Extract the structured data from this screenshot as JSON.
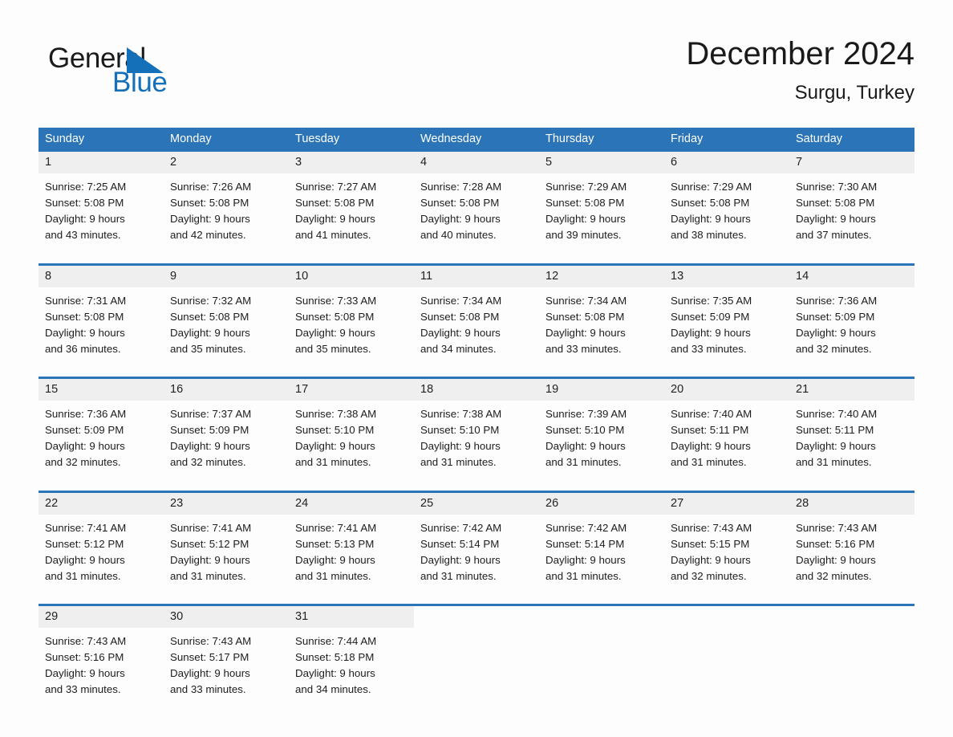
{
  "brand": {
    "name_part1": "General",
    "name_part2": "Blue",
    "accent_color": "#1470b8",
    "triangle_icon": "brand-triangle-icon"
  },
  "header": {
    "month_title": "December 2024",
    "location": "Surgu, Turkey"
  },
  "calendar": {
    "header_bg": "#2a74b7",
    "daynum_bg": "#efefef",
    "weekdays": [
      "Sunday",
      "Monday",
      "Tuesday",
      "Wednesday",
      "Thursday",
      "Friday",
      "Saturday"
    ],
    "weeks": [
      [
        {
          "day": "1",
          "sunrise": "Sunrise: 7:25 AM",
          "sunset": "Sunset: 5:08 PM",
          "daylight_line1": "Daylight: 9 hours",
          "daylight_line2": "and 43 minutes."
        },
        {
          "day": "2",
          "sunrise": "Sunrise: 7:26 AM",
          "sunset": "Sunset: 5:08 PM",
          "daylight_line1": "Daylight: 9 hours",
          "daylight_line2": "and 42 minutes."
        },
        {
          "day": "3",
          "sunrise": "Sunrise: 7:27 AM",
          "sunset": "Sunset: 5:08 PM",
          "daylight_line1": "Daylight: 9 hours",
          "daylight_line2": "and 41 minutes."
        },
        {
          "day": "4",
          "sunrise": "Sunrise: 7:28 AM",
          "sunset": "Sunset: 5:08 PM",
          "daylight_line1": "Daylight: 9 hours",
          "daylight_line2": "and 40 minutes."
        },
        {
          "day": "5",
          "sunrise": "Sunrise: 7:29 AM",
          "sunset": "Sunset: 5:08 PM",
          "daylight_line1": "Daylight: 9 hours",
          "daylight_line2": "and 39 minutes."
        },
        {
          "day": "6",
          "sunrise": "Sunrise: 7:29 AM",
          "sunset": "Sunset: 5:08 PM",
          "daylight_line1": "Daylight: 9 hours",
          "daylight_line2": "and 38 minutes."
        },
        {
          "day": "7",
          "sunrise": "Sunrise: 7:30 AM",
          "sunset": "Sunset: 5:08 PM",
          "daylight_line1": "Daylight: 9 hours",
          "daylight_line2": "and 37 minutes."
        }
      ],
      [
        {
          "day": "8",
          "sunrise": "Sunrise: 7:31 AM",
          "sunset": "Sunset: 5:08 PM",
          "daylight_line1": "Daylight: 9 hours",
          "daylight_line2": "and 36 minutes."
        },
        {
          "day": "9",
          "sunrise": "Sunrise: 7:32 AM",
          "sunset": "Sunset: 5:08 PM",
          "daylight_line1": "Daylight: 9 hours",
          "daylight_line2": "and 35 minutes."
        },
        {
          "day": "10",
          "sunrise": "Sunrise: 7:33 AM",
          "sunset": "Sunset: 5:08 PM",
          "daylight_line1": "Daylight: 9 hours",
          "daylight_line2": "and 35 minutes."
        },
        {
          "day": "11",
          "sunrise": "Sunrise: 7:34 AM",
          "sunset": "Sunset: 5:08 PM",
          "daylight_line1": "Daylight: 9 hours",
          "daylight_line2": "and 34 minutes."
        },
        {
          "day": "12",
          "sunrise": "Sunrise: 7:34 AM",
          "sunset": "Sunset: 5:08 PM",
          "daylight_line1": "Daylight: 9 hours",
          "daylight_line2": "and 33 minutes."
        },
        {
          "day": "13",
          "sunrise": "Sunrise: 7:35 AM",
          "sunset": "Sunset: 5:09 PM",
          "daylight_line1": "Daylight: 9 hours",
          "daylight_line2": "and 33 minutes."
        },
        {
          "day": "14",
          "sunrise": "Sunrise: 7:36 AM",
          "sunset": "Sunset: 5:09 PM",
          "daylight_line1": "Daylight: 9 hours",
          "daylight_line2": "and 32 minutes."
        }
      ],
      [
        {
          "day": "15",
          "sunrise": "Sunrise: 7:36 AM",
          "sunset": "Sunset: 5:09 PM",
          "daylight_line1": "Daylight: 9 hours",
          "daylight_line2": "and 32 minutes."
        },
        {
          "day": "16",
          "sunrise": "Sunrise: 7:37 AM",
          "sunset": "Sunset: 5:09 PM",
          "daylight_line1": "Daylight: 9 hours",
          "daylight_line2": "and 32 minutes."
        },
        {
          "day": "17",
          "sunrise": "Sunrise: 7:38 AM",
          "sunset": "Sunset: 5:10 PM",
          "daylight_line1": "Daylight: 9 hours",
          "daylight_line2": "and 31 minutes."
        },
        {
          "day": "18",
          "sunrise": "Sunrise: 7:38 AM",
          "sunset": "Sunset: 5:10 PM",
          "daylight_line1": "Daylight: 9 hours",
          "daylight_line2": "and 31 minutes."
        },
        {
          "day": "19",
          "sunrise": "Sunrise: 7:39 AM",
          "sunset": "Sunset: 5:10 PM",
          "daylight_line1": "Daylight: 9 hours",
          "daylight_line2": "and 31 minutes."
        },
        {
          "day": "20",
          "sunrise": "Sunrise: 7:40 AM",
          "sunset": "Sunset: 5:11 PM",
          "daylight_line1": "Daylight: 9 hours",
          "daylight_line2": "and 31 minutes."
        },
        {
          "day": "21",
          "sunrise": "Sunrise: 7:40 AM",
          "sunset": "Sunset: 5:11 PM",
          "daylight_line1": "Daylight: 9 hours",
          "daylight_line2": "and 31 minutes."
        }
      ],
      [
        {
          "day": "22",
          "sunrise": "Sunrise: 7:41 AM",
          "sunset": "Sunset: 5:12 PM",
          "daylight_line1": "Daylight: 9 hours",
          "daylight_line2": "and 31 minutes."
        },
        {
          "day": "23",
          "sunrise": "Sunrise: 7:41 AM",
          "sunset": "Sunset: 5:12 PM",
          "daylight_line1": "Daylight: 9 hours",
          "daylight_line2": "and 31 minutes."
        },
        {
          "day": "24",
          "sunrise": "Sunrise: 7:41 AM",
          "sunset": "Sunset: 5:13 PM",
          "daylight_line1": "Daylight: 9 hours",
          "daylight_line2": "and 31 minutes."
        },
        {
          "day": "25",
          "sunrise": "Sunrise: 7:42 AM",
          "sunset": "Sunset: 5:14 PM",
          "daylight_line1": "Daylight: 9 hours",
          "daylight_line2": "and 31 minutes."
        },
        {
          "day": "26",
          "sunrise": "Sunrise: 7:42 AM",
          "sunset": "Sunset: 5:14 PM",
          "daylight_line1": "Daylight: 9 hours",
          "daylight_line2": "and 31 minutes."
        },
        {
          "day": "27",
          "sunrise": "Sunrise: 7:43 AM",
          "sunset": "Sunset: 5:15 PM",
          "daylight_line1": "Daylight: 9 hours",
          "daylight_line2": "and 32 minutes."
        },
        {
          "day": "28",
          "sunrise": "Sunrise: 7:43 AM",
          "sunset": "Sunset: 5:16 PM",
          "daylight_line1": "Daylight: 9 hours",
          "daylight_line2": "and 32 minutes."
        }
      ],
      [
        {
          "day": "29",
          "sunrise": "Sunrise: 7:43 AM",
          "sunset": "Sunset: 5:16 PM",
          "daylight_line1": "Daylight: 9 hours",
          "daylight_line2": "and 33 minutes."
        },
        {
          "day": "30",
          "sunrise": "Sunrise: 7:43 AM",
          "sunset": "Sunset: 5:17 PM",
          "daylight_line1": "Daylight: 9 hours",
          "daylight_line2": "and 33 minutes."
        },
        {
          "day": "31",
          "sunrise": "Sunrise: 7:44 AM",
          "sunset": "Sunset: 5:18 PM",
          "daylight_line1": "Daylight: 9 hours",
          "daylight_line2": "and 34 minutes."
        },
        {
          "day": "",
          "sunrise": "",
          "sunset": "",
          "daylight_line1": "",
          "daylight_line2": "",
          "empty": true
        },
        {
          "day": "",
          "sunrise": "",
          "sunset": "",
          "daylight_line1": "",
          "daylight_line2": "",
          "empty": true
        },
        {
          "day": "",
          "sunrise": "",
          "sunset": "",
          "daylight_line1": "",
          "daylight_line2": "",
          "empty": true
        },
        {
          "day": "",
          "sunrise": "",
          "sunset": "",
          "daylight_line1": "",
          "daylight_line2": "",
          "empty": true
        }
      ]
    ]
  }
}
